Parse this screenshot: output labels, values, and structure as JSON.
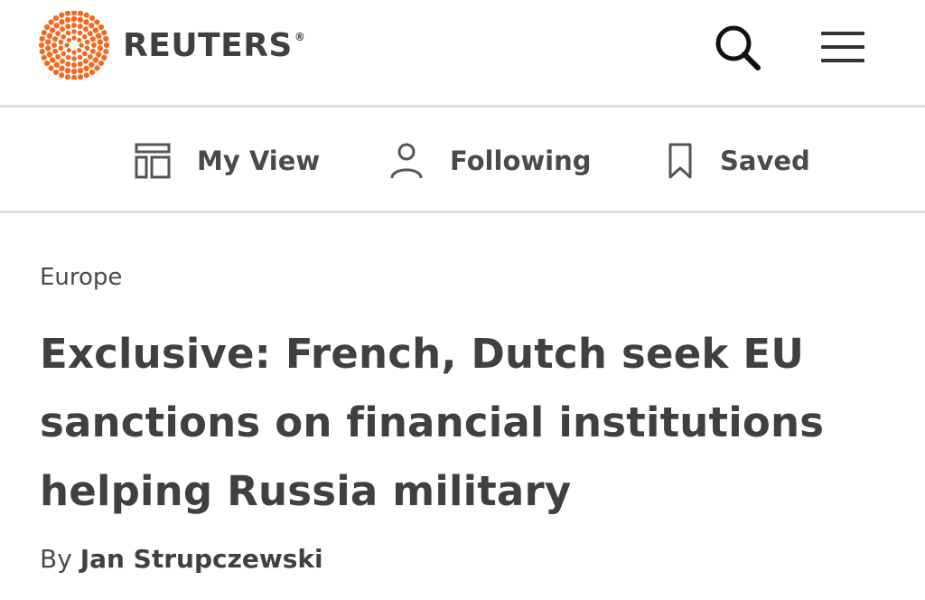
{
  "header": {
    "brand": "REUTERS",
    "brand_mark": "®",
    "logo_color": "#f26a21",
    "icons": {
      "search": "search-icon",
      "menu": "hamburger-menu-icon"
    }
  },
  "subnav": {
    "items": [
      {
        "label": "My View",
        "icon": "layout-grid-icon"
      },
      {
        "label": "Following",
        "icon": "person-icon"
      },
      {
        "label": "Saved",
        "icon": "bookmark-icon"
      }
    ]
  },
  "article": {
    "category": "Europe",
    "headline": "Exclusive: French, Dutch seek EU sanctions on financial institutions helping Russia military",
    "byline_prefix": "By",
    "author": "Jan Strupczewski"
  }
}
